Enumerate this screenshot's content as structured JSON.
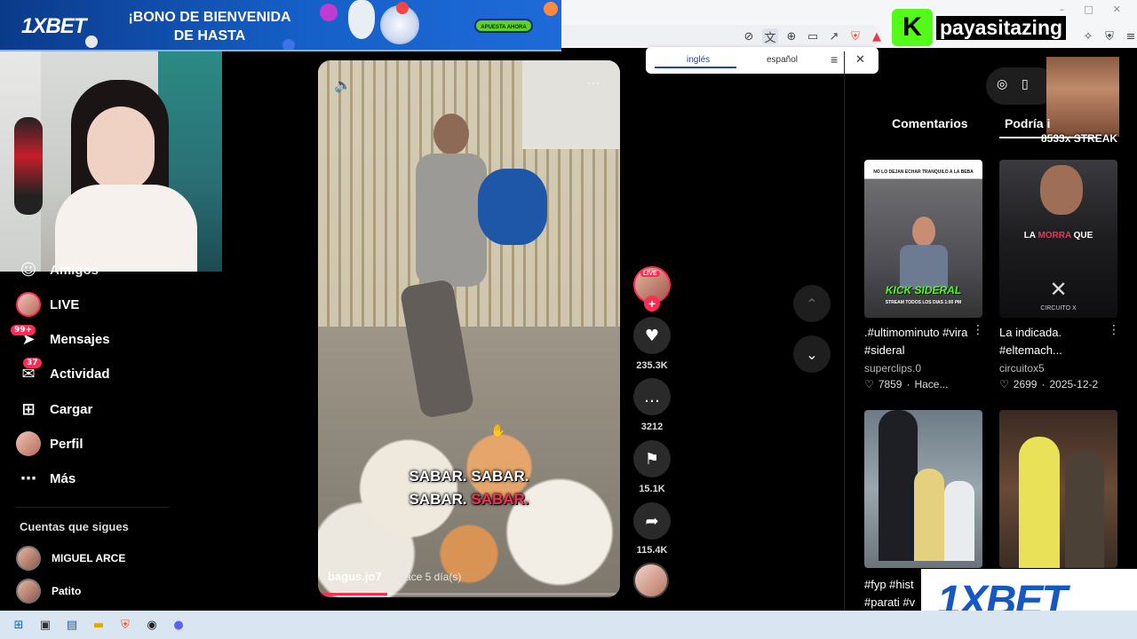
{
  "ad_top": {
    "brand": "1XBET",
    "headline": "¡BONO DE BIENVENIDA DE HASTA",
    "cta": "APUESTA AHORA"
  },
  "translate_popup": {
    "lang_from": "inglés",
    "lang_to": "español"
  },
  "streamer": {
    "name": "payasitazing",
    "logo_letter": "K",
    "streak": "8533x STREAK"
  },
  "sidebar": {
    "items": [
      {
        "label": "Amigos",
        "icon": "users-icon"
      },
      {
        "label": "LIVE",
        "icon": "live-avatar"
      },
      {
        "label": "Mensajes",
        "icon": "send-icon",
        "badge": "99+"
      },
      {
        "label": "Actividad",
        "icon": "inbox-icon",
        "badge": "37"
      },
      {
        "label": "Cargar",
        "icon": "plus-square-icon"
      },
      {
        "label": "Perfil",
        "icon": "profile-avatar"
      },
      {
        "label": "Más",
        "icon": "more-icon"
      }
    ],
    "following_title": "Cuentas que sigues",
    "following": [
      {
        "name": "MIGUEL ARCE"
      },
      {
        "name": "Patito"
      }
    ]
  },
  "video": {
    "caption_line1": "SABAR. SABAR.",
    "caption_line2_a": "SABAR.",
    "caption_line2_b": "SABAR.",
    "author": "bagus.jo7",
    "time": "· Hace 5 día(s)",
    "progress": 0.23
  },
  "actions": {
    "live_badge": "LIVE",
    "likes": "235.3K",
    "comments": "3212",
    "saves": "15.1K",
    "shares": "115.4K"
  },
  "right_panel": {
    "tabs": [
      "Comentarios",
      "Podría i"
    ],
    "cards": [
      {
        "thumb_top_text": "NO LO DEJAN ECHAR TRANQUILO A LA BEBA",
        "thumb_brand": "KICK SIDERAL",
        "thumb_sub": "STREAM TODOS LOS DIAS 1:00 PM",
        "title": ".#ultimominuto #vira #sideral",
        "author": "superclips.0",
        "likes": "7859",
        "date": "Hace..."
      },
      {
        "thumb_text_a": "LA ",
        "thumb_text_b": "MORRA",
        "thumb_text_c": " QUE",
        "thumb_brand": "CIRCUITO X",
        "title": "La indicada. #eltemach...",
        "author": "circuitox5",
        "likes": "2699",
        "date": "2025-12-2"
      },
      {
        "title": "#fyp #hist #parati #v"
      },
      {
        "title": ""
      }
    ]
  },
  "ad_bottom": {
    "brand": "1XBET"
  },
  "colors": {
    "accent": "#fe2c55",
    "kick_green": "#53fc18",
    "ad_blue": "#1658c3"
  }
}
